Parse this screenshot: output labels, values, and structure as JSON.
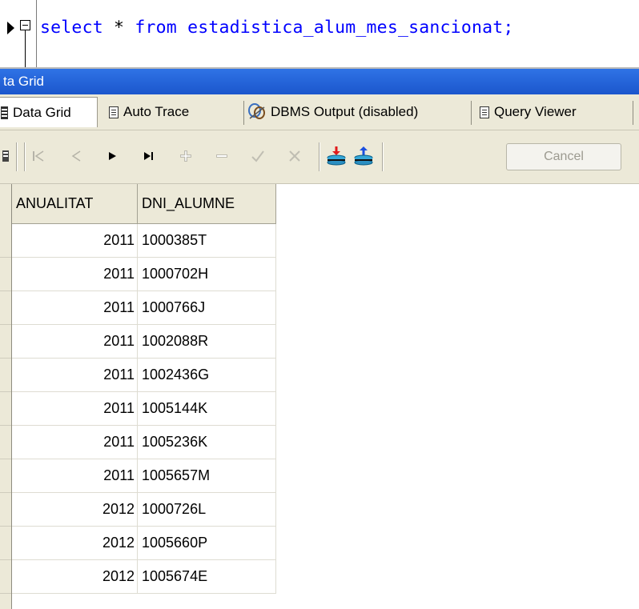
{
  "editor": {
    "sql_keyword_1": "select",
    "sql_star": "*",
    "sql_keyword_2": "from",
    "sql_table": "estadistica_alum_mes_sancionat;",
    "text_color": "#0000ff"
  },
  "panel": {
    "title": "ta Grid",
    "title_bar_color": "#1f5fd6"
  },
  "tabs": [
    {
      "label": "Data Grid",
      "icon": "grid-icon",
      "active": true
    },
    {
      "label": "Auto Trace",
      "icon": "document-icon",
      "active": false
    },
    {
      "label": "DBMS Output (disabled)",
      "icon": "dbms-output-icon",
      "active": false
    },
    {
      "label": "Query Viewer",
      "icon": "document-icon",
      "active": false
    }
  ],
  "toolbar": {
    "buttons": [
      "first-record-icon",
      "prior-record-icon",
      "next-record-icon",
      "last-record-icon",
      "insert-record-icon",
      "delete-record-icon",
      "post-edit-icon",
      "cancel-edit-icon",
      "export-data-icon",
      "import-data-icon"
    ],
    "cancel_label": "Cancel"
  },
  "grid": {
    "columns": [
      "ANUALITAT",
      "DNI_ALUMNE"
    ],
    "rows": [
      [
        "2011",
        "1000385T"
      ],
      [
        "2011",
        "1000702H"
      ],
      [
        "2011",
        "1000766J"
      ],
      [
        "2011",
        "1002088R"
      ],
      [
        "2011",
        "1002436G"
      ],
      [
        "2011",
        "1005144K"
      ],
      [
        "2011",
        "1005236K"
      ],
      [
        "2011",
        "1005657M"
      ],
      [
        "2012",
        "1000726L"
      ],
      [
        "2012",
        "1005660P"
      ],
      [
        "2012",
        "1005674E"
      ]
    ]
  }
}
